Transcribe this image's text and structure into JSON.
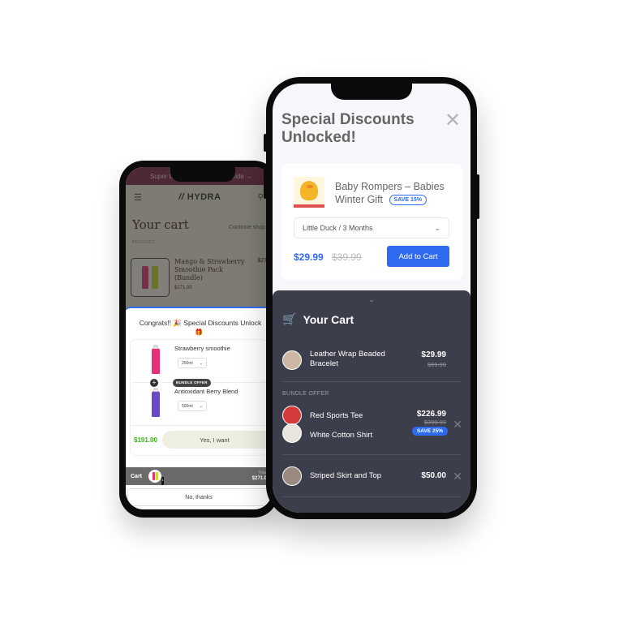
{
  "left_phone": {
    "banner": {
      "left_text": "Super D",
      "right_text": "Wide →"
    },
    "header": {
      "logo": "HYDRA",
      "menu_icon": "hamburger-icon",
      "search_icon": "search-icon"
    },
    "cart_page": {
      "title": "Your cart",
      "continue_link": "Continue shop",
      "product_column_label": "PRODUCT",
      "item": {
        "name": "Mango & Strawberry Smoothie Pack (Bundle)",
        "price": "$271.00",
        "line_total": "$27"
      }
    },
    "popup": {
      "title": "Congrats!! 🎉 Special Discounts Unlock",
      "gift_emoji": "🎁",
      "items": [
        {
          "name": "Strawberry smoothie",
          "option": "250ml",
          "color": "#e8307a"
        },
        {
          "name": "Antioxidant Berry Blend",
          "option": "500ml",
          "color": "#6a48c8"
        }
      ],
      "bundle_tag": "BUNDLE OFFER",
      "plus_symbol": "+",
      "offer_price": "$191.00",
      "accept_label": "Yes, I want",
      "decline_label": "No, thanks"
    },
    "cart_bar": {
      "label": "Cart",
      "badge_count": "1",
      "total_label": "Total",
      "total_value": "$271.0"
    }
  },
  "right_phone": {
    "title": "Special Discounts Unlocked!",
    "close_icon": "close-icon",
    "offer": {
      "product_name": "Baby Rompers – Babies Winter Gift",
      "save_badge": "SAVE 15%",
      "variant": "Little Duck / 3 Months",
      "price": "$29.99",
      "compare_price": "$39.99",
      "add_label": "Add to Cart"
    },
    "cart": {
      "title": "Your Cart",
      "handle_icon": "chevron-down-icon",
      "items": [
        {
          "name": "Leather Wrap Beaded Bracelet",
          "price": "$29.99",
          "compare_price": "$69.99"
        }
      ],
      "bundle": {
        "label": "BUNDLE OFFER",
        "items": [
          {
            "name": "Red Sports Tee"
          },
          {
            "name": "White Cotton Shirt"
          }
        ],
        "price": "$226.99",
        "compare_price": "$399.99",
        "save_badge": "SAVE 25%"
      },
      "extra_items": [
        {
          "name": "Striped Skirt and Top",
          "price": "$50.00"
        }
      ]
    }
  },
  "colors": {
    "accent_blue": "#2f6bf0",
    "offer_green": "#3db31c",
    "banner_maroon": "#7a1f45",
    "cart_dark": "#3d3e4b"
  }
}
